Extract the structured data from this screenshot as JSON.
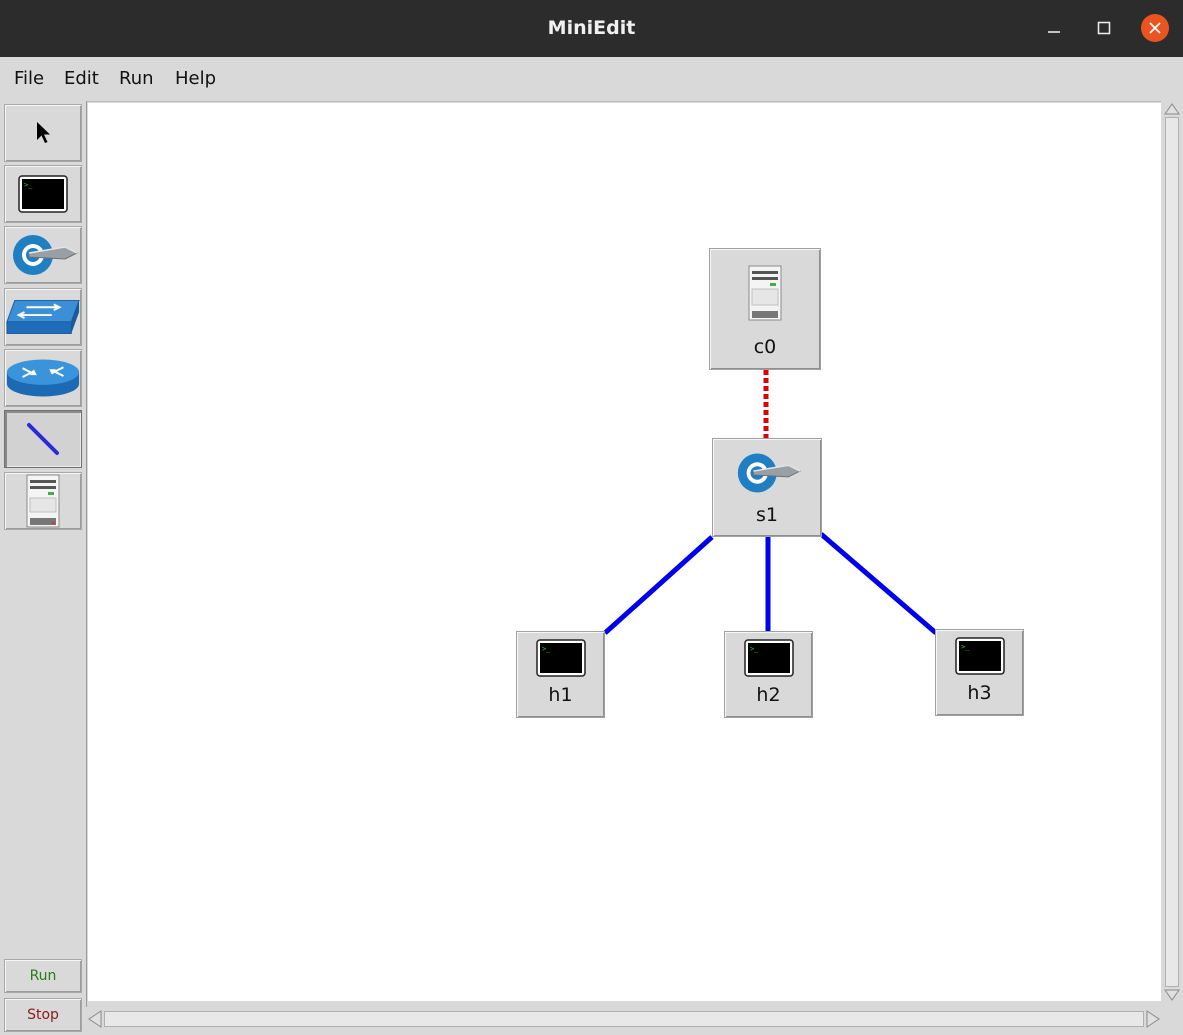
{
  "window": {
    "title": "MiniEdit"
  },
  "menu": [
    "File",
    "Edit",
    "Run",
    "Help"
  ],
  "toolbar": {
    "tools": [
      "select-tool",
      "host-tool",
      "switch-tool",
      "legacy-switch-tool",
      "legacy-router-tool",
      "netlink-tool",
      "controller-tool"
    ],
    "selected": "netlink-tool",
    "run_label": "Run",
    "stop_label": "Stop"
  },
  "colors": {
    "link": "#0000ee",
    "controller_link": "#e00000",
    "run": "#2a7a1a",
    "stop": "#8b1a1a",
    "close": "#e95420"
  },
  "nodes": {
    "c0": {
      "label": "c0",
      "type": "controller"
    },
    "s1": {
      "label": "s1",
      "type": "switch"
    },
    "h1": {
      "label": "h1",
      "type": "host"
    },
    "h2": {
      "label": "h2",
      "type": "host"
    },
    "h3": {
      "label": "h3",
      "type": "host"
    }
  },
  "links": [
    {
      "from": "c0",
      "to": "s1",
      "style": "dashed-red"
    },
    {
      "from": "s1",
      "to": "h1",
      "style": "solid-blue"
    },
    {
      "from": "s1",
      "to": "h2",
      "style": "solid-blue"
    },
    {
      "from": "s1",
      "to": "h3",
      "style": "solid-blue"
    }
  ]
}
